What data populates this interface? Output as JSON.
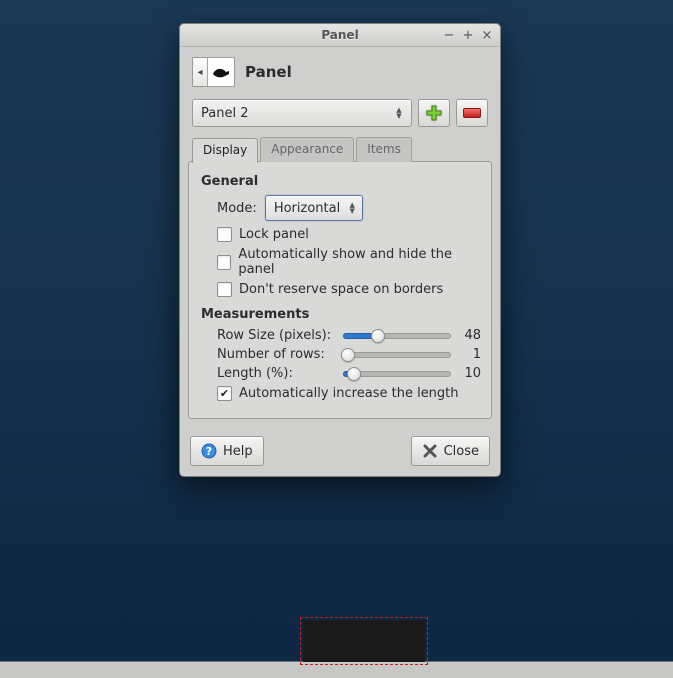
{
  "window": {
    "title": "Panel"
  },
  "header": {
    "title": "Panel"
  },
  "selector": {
    "value": "Panel 2"
  },
  "tabs": {
    "display": "Display",
    "appearance": "Appearance",
    "items": "Items"
  },
  "general": {
    "title": "General",
    "mode_label": "Mode:",
    "mode_value": "Horizontal",
    "lock_label": "Lock panel",
    "autohide_label": "Automatically show and hide the panel",
    "noborders_label": "Don't reserve space on borders"
  },
  "measurements": {
    "title": "Measurements",
    "row_size_label": "Row Size (pixels):",
    "row_size_value": "48",
    "num_rows_label": "Number of rows:",
    "num_rows_value": "1",
    "length_label": "Length (%):",
    "length_value": "10",
    "auto_length_label": "Automatically increase the length"
  },
  "footer": {
    "help": "Help",
    "close": "Close"
  }
}
